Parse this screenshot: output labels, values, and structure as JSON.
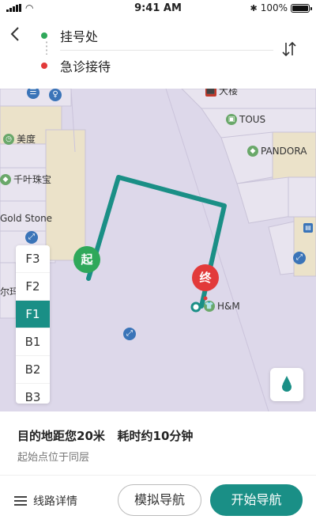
{
  "status_bar": {
    "time": "9:41 AM",
    "battery": "100%"
  },
  "header": {
    "from": "挂号处",
    "to": "急诊接待",
    "colors": {
      "from_dot": "#2fa85a",
      "to_dot": "#e23a3a"
    },
    "icons": {
      "back": "chevron-left-icon",
      "swap": "swap-vertical-icon"
    }
  },
  "map": {
    "stores": {
      "top_store": "大楼",
      "tous": "TOUS",
      "pandora": "PANDORA",
      "meidu": "美度",
      "qianye": "千叶珠宝",
      "gold_stone": "Gold Stone",
      "erma": "尔玛",
      "hm": "H&M"
    },
    "start_label": "起",
    "end_label": "终",
    "colors": {
      "route": "#1a8f86",
      "map_bg": "#ddd8ea"
    }
  },
  "floors": {
    "items": [
      "F3",
      "F2",
      "F1",
      "B1",
      "B2",
      "B3"
    ],
    "active": "F1"
  },
  "info": {
    "summary": "目的地距您20米   耗时约10分钟",
    "note": "起始点位于同层"
  },
  "actions": {
    "details_label": "线路详情",
    "simulate_label": "模拟导航",
    "start_label": "开始导航"
  }
}
